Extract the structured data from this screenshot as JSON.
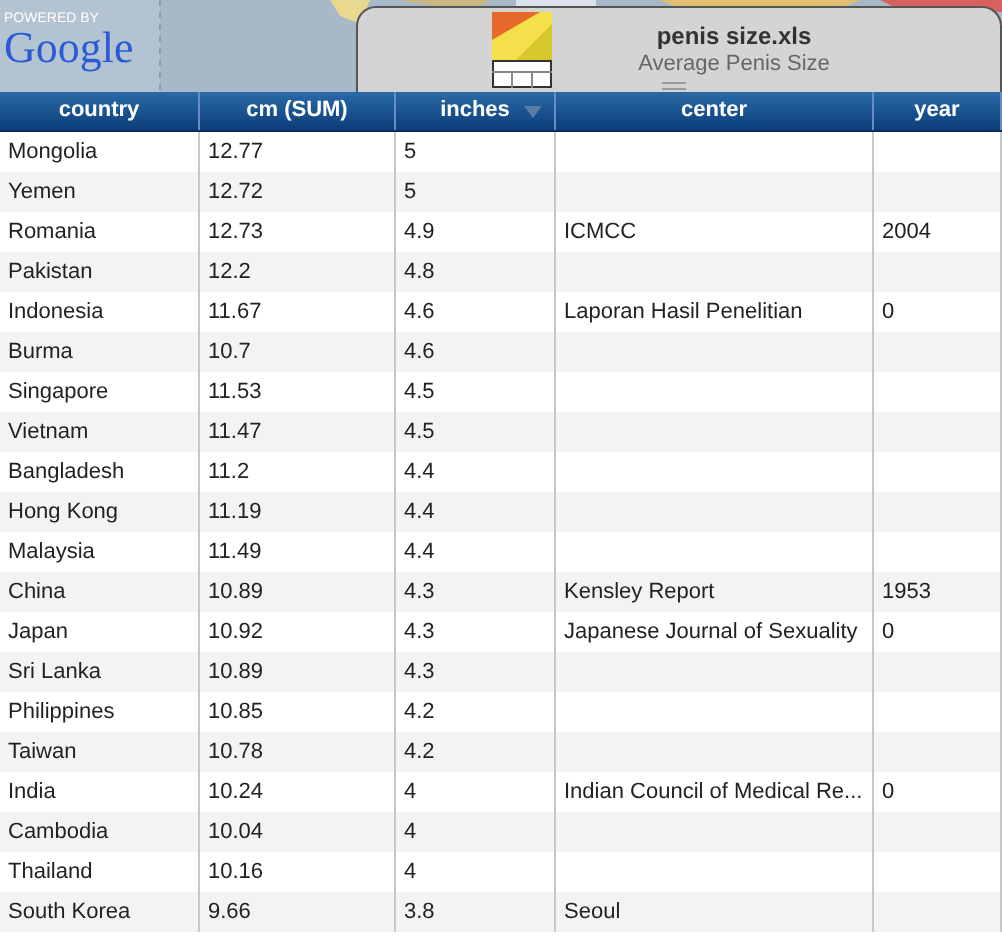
{
  "map": {
    "attribution": {
      "prefix": "POWERED BY",
      "brand": "Google"
    }
  },
  "file": {
    "title": "penis size.xls",
    "subtitle": "Average Penis Size"
  },
  "table": {
    "columns": [
      {
        "label": "country",
        "sorted": false
      },
      {
        "label": "cm (SUM)",
        "sorted": false
      },
      {
        "label": "inches",
        "sorted": true
      },
      {
        "label": "center",
        "sorted": false
      },
      {
        "label": "year",
        "sorted": false
      }
    ],
    "rows": [
      [
        "Mongolia",
        "12.77",
        "5",
        "",
        ""
      ],
      [
        "Yemen",
        "12.72",
        "5",
        "",
        ""
      ],
      [
        "Romania",
        "12.73",
        "4.9",
        "ICMCC",
        "2004"
      ],
      [
        "Pakistan",
        "12.2",
        "4.8",
        "",
        ""
      ],
      [
        "Indonesia",
        "11.67",
        "4.6",
        "Laporan Hasil Penelitian",
        "0"
      ],
      [
        "Burma",
        "10.7",
        "4.6",
        "",
        ""
      ],
      [
        "Singapore",
        "11.53",
        "4.5",
        "",
        ""
      ],
      [
        "Vietnam",
        "11.47",
        "4.5",
        "",
        ""
      ],
      [
        "Bangladesh",
        "11.2",
        "4.4",
        "",
        ""
      ],
      [
        "Hong Kong",
        "11.19",
        "4.4",
        "",
        ""
      ],
      [
        "Malaysia",
        "11.49",
        "4.4",
        "",
        ""
      ],
      [
        "China",
        "10.89",
        "4.3",
        "Kensley Report",
        "1953"
      ],
      [
        "Japan",
        "10.92",
        "4.3",
        "Japanese Journal of Sexuality",
        "0"
      ],
      [
        "Sri Lanka",
        "10.89",
        "4.3",
        "",
        ""
      ],
      [
        "Philippines",
        "10.85",
        "4.2",
        "",
        ""
      ],
      [
        "Taiwan",
        "10.78",
        "4.2",
        "",
        ""
      ],
      [
        "India",
        "10.24",
        "4",
        "Indian Council of Medical Re...",
        "0"
      ],
      [
        "Cambodia",
        "10.04",
        "4",
        "",
        ""
      ],
      [
        "Thailand",
        "10.16",
        "4",
        "",
        ""
      ],
      [
        "South Korea",
        "9.66",
        "3.8",
        "Seoul",
        ""
      ]
    ]
  }
}
